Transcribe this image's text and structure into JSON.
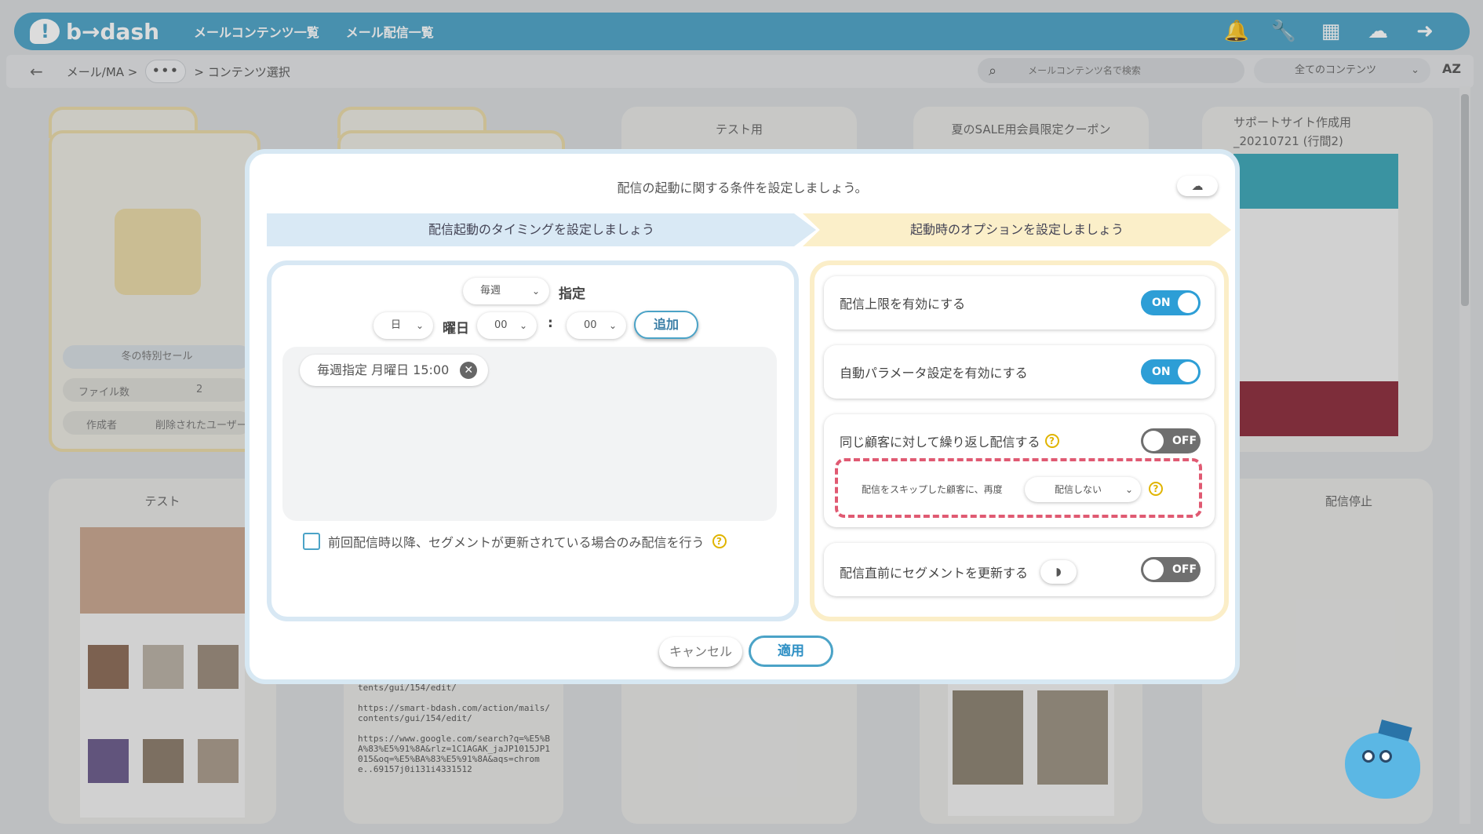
{
  "app": {
    "logo_text": "b→dash",
    "nav": [
      "メールコンテンツ一覧",
      "メール配信一覧"
    ]
  },
  "subheader": {
    "crumb_root": "メール/MA >",
    "crumb_more": "•••",
    "crumb_current": "> コンテンツ選択",
    "search_placeholder": "メールコンテンツ名で検索",
    "filter_value": "全てのコンテンツ",
    "sort_label": "AZ"
  },
  "cards": {
    "c1": {
      "title": "冬の特別セール",
      "files_label": "ファイル数",
      "files_value": "2",
      "author_label": "作成者",
      "author_value": "削除されたユーザー"
    },
    "c3": {
      "title": "テスト用"
    },
    "c4": {
      "title": "夏のSALE用会員限定クーポン"
    },
    "c5": {
      "title": "サポートサイト作成用_20210721 (行間2)"
    },
    "c6": {
      "title": "テスト"
    },
    "c10": {
      "title": "配信停止"
    },
    "c7_text": "tents/gui/154/edit/\n\nhttps://smart-bdash.com/action/mails/contents/gui/154/edit/\n\nhttps://www.google.com/search?q=%E5%BA%83%E5%91%8A&rlz=1C1AGAK_jaJP1015JP1015&oq=%E5%BA%83%E5%91%8A&aqs=chrome..69157j0i131i4331512"
  },
  "modal": {
    "title": "配信の起動に関する条件を設定しましょう。",
    "step1": "配信起動のタイミングを設定しましょう",
    "step2": "起動時のオプションを設定しましょう",
    "left": {
      "frequency_value": "毎週",
      "frequency_suffix": "指定",
      "weekday_value": "日",
      "weekday_suffix": "曜日",
      "hour_value": "00",
      "time_sep": ":",
      "minute_value": "00",
      "add_label": "追加",
      "schedules": [
        "毎週指定 月曜日 15:00"
      ],
      "segment_check_label": "前回配信時以降、セグメントが更新されている場合のみ配信を行う"
    },
    "right": {
      "opt1_label": "配信上限を有効にする",
      "opt1_state": "ON",
      "opt2_label": "自動パラメータ設定を有効にする",
      "opt2_state": "ON",
      "opt3_label": "同じ顧客に対して繰り返し配信する",
      "opt3_state": "OFF",
      "opt3_sub_label": "配信をスキップした顧客に、再度",
      "opt3_sub_value": "配信しない",
      "opt4_label": "配信直前にセグメントを更新する",
      "opt4_state": "OFF"
    },
    "cancel_label": "キャンセル",
    "apply_label": "適用"
  },
  "colors": {
    "brand": "#4ba3c7",
    "toggle_on": "#2d9ed6",
    "toggle_off": "#6f6f6f",
    "highlight_dash": "#e05a72"
  }
}
